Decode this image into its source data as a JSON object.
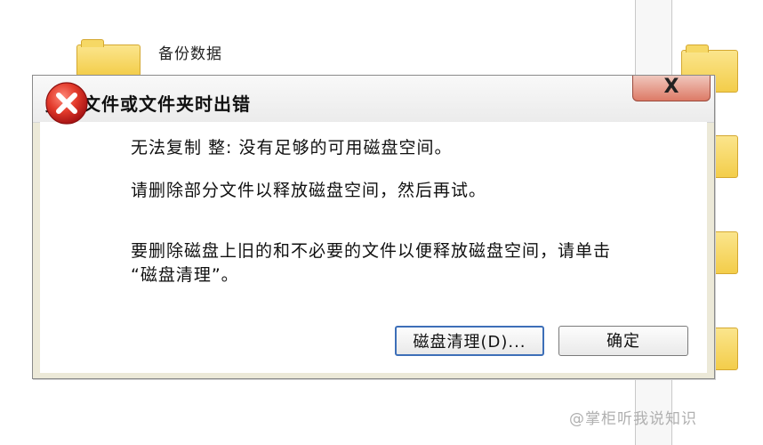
{
  "background": {
    "text": "备份数据"
  },
  "dialog": {
    "title": "复制文件或文件夹时出错",
    "close_label": "X",
    "messages": [
      "无法复制 整: 没有足够的可用磁盘空间。",
      "请删除部分文件以释放磁盘空间，然后再试。",
      "要删除磁盘上旧的和不必要的文件以便释放磁盘空间，请单击",
      "“磁盘清理”。"
    ],
    "buttons": {
      "cleanup": "磁盘清理(D)...",
      "ok": "确定"
    },
    "icon": "error-icon"
  },
  "watermark": "@掌柜听我说知识",
  "colors": {
    "dialog_bg": "#ece9d8",
    "close_button": "#dd7a66",
    "error_icon": "#d42626",
    "default_button_border": "#3d6fb8"
  }
}
